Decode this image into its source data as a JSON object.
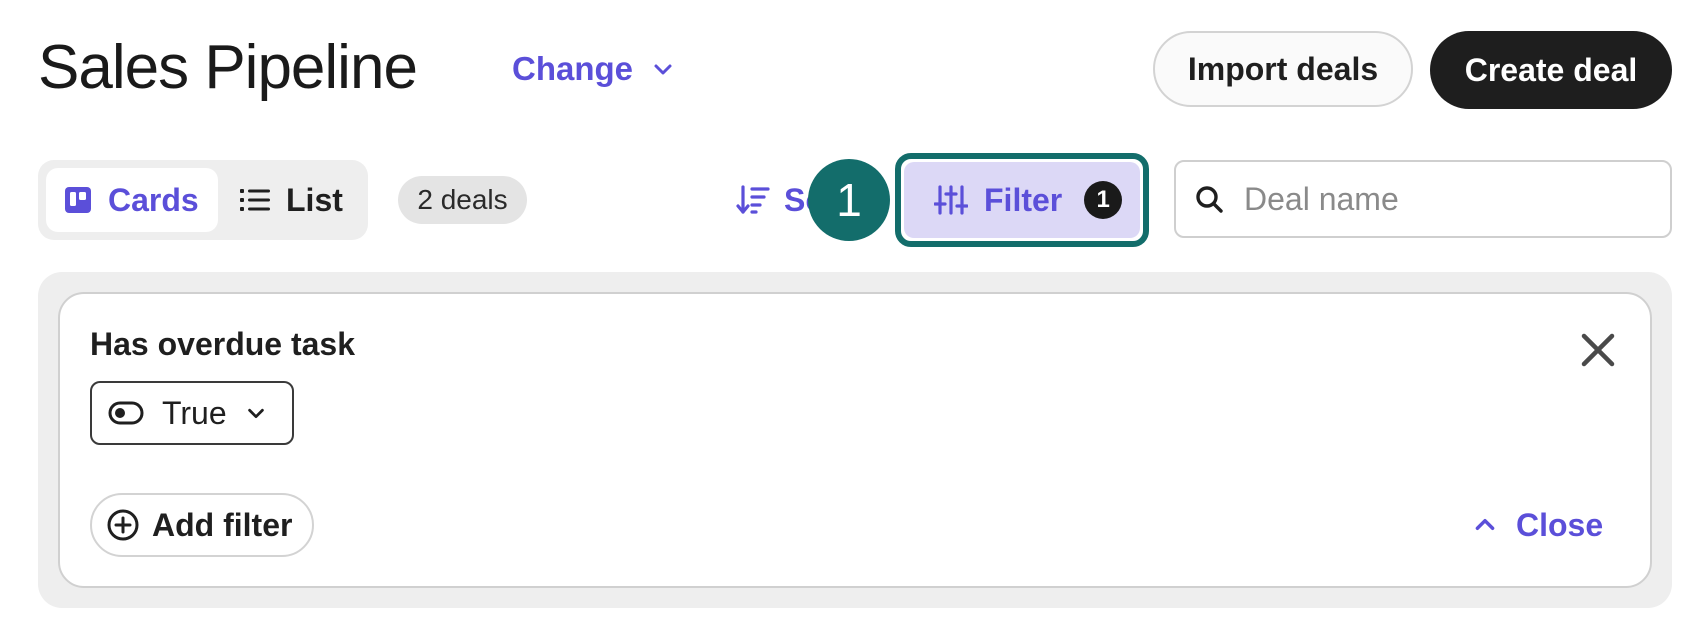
{
  "header": {
    "title": "Sales Pipeline",
    "change_label": "Change",
    "import_label": "Import deals",
    "create_label": "Create deal"
  },
  "toolbar": {
    "views": [
      {
        "label": "Cards",
        "icon": "board-icon",
        "active": true
      },
      {
        "label": "List",
        "icon": "list-icon",
        "active": false
      }
    ],
    "deals_count": "2 deals",
    "sort_label": "Sort",
    "filter_label": "Filter",
    "filter_count": "1",
    "step_marker": "1",
    "search": {
      "value": "",
      "placeholder": "Deal name"
    }
  },
  "filter_panel": {
    "filters": [
      {
        "label": "Has overdue task",
        "value": "True",
        "icon": "toggle-icon"
      }
    ],
    "add_filter_label": "Add filter",
    "close_label": "Close"
  },
  "colors": {
    "accent": "#5b4fd9",
    "highlight": "#136d6b",
    "filter_bg": "#dcd8f6",
    "dark_button": "#1e1e1e"
  }
}
